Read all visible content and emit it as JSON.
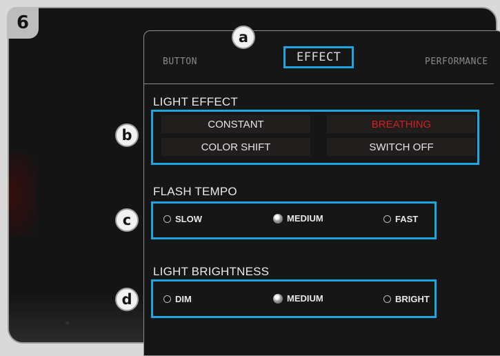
{
  "step_badge": "6",
  "tabs": [
    {
      "label": "BUTTON",
      "active": false
    },
    {
      "label": "EFFECT",
      "active": true
    },
    {
      "label": "PERFORMANCE",
      "active": false
    }
  ],
  "light_effect": {
    "title": "LIGHT EFFECT",
    "options": [
      "CONSTANT",
      "BREATHING",
      "COLOR SHIFT",
      "SWITCH OFF"
    ],
    "selected": "BREATHING"
  },
  "flash_tempo": {
    "title": "FLASH TEMPO",
    "options": [
      "SLOW",
      "MEDIUM",
      "FAST"
    ],
    "selected": "MEDIUM"
  },
  "light_brightness": {
    "title": "LIGHT BRIGHTNESS",
    "options": [
      "DIM",
      "MEDIUM",
      "BRIGHT"
    ],
    "selected": "MEDIUM"
  },
  "callouts": [
    "a",
    "b",
    "c",
    "d"
  ],
  "colors": {
    "highlight": "#1da6e0",
    "selected_text": "#d02020",
    "background": "#141414"
  }
}
